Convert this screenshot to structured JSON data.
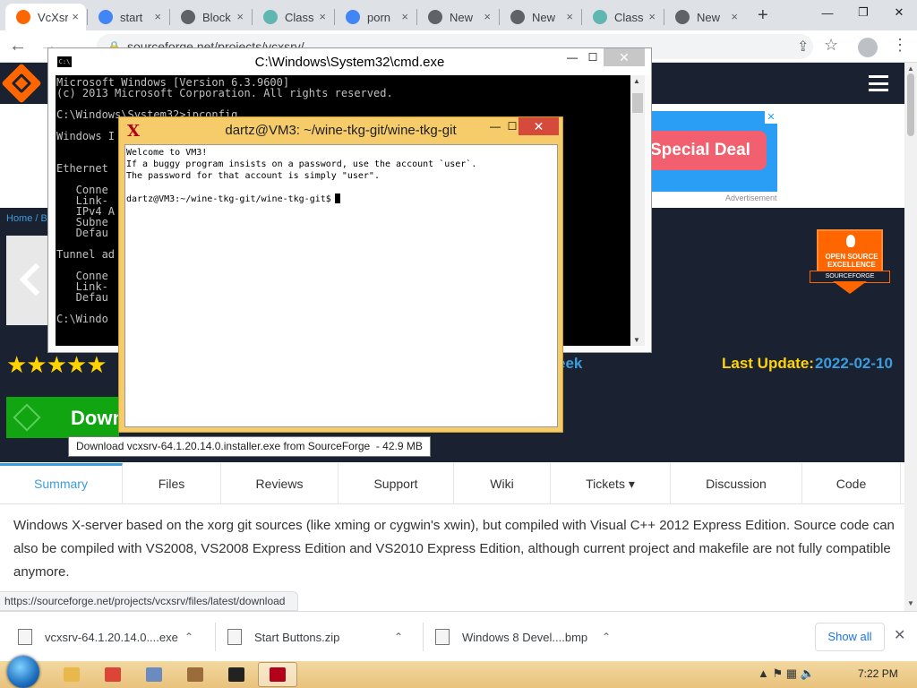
{
  "browser": {
    "tabs": [
      {
        "title": "VcXsr",
        "active": true,
        "favicon_color": "#ff6600"
      },
      {
        "title": "start",
        "active": false,
        "favicon_color": "#4285f4"
      },
      {
        "title": "Block",
        "active": false,
        "favicon_color": "#5f6368"
      },
      {
        "title": "Class",
        "active": false,
        "favicon_color": "#5fb7b0"
      },
      {
        "title": "porn",
        "active": false,
        "favicon_color": "#4285f4"
      },
      {
        "title": "New",
        "active": false,
        "favicon_color": "#5f6368"
      },
      {
        "title": "New",
        "active": false,
        "favicon_color": "#5f6368"
      },
      {
        "title": "Class",
        "active": false,
        "favicon_color": "#5fb7b0"
      },
      {
        "title": "New",
        "active": false,
        "favicon_color": "#5f6368"
      }
    ],
    "new_tab_glyph": "+",
    "tab_close_glyph": "×",
    "window_controls": {
      "minimize": "—",
      "restore": "❐",
      "close": "✕"
    },
    "back_glyph": "←",
    "forward_glyph": "→",
    "url": "sourceforge.net/projects/vcxsrv/",
    "lock_glyph": "🔒",
    "share_glyph": "⇪",
    "star_glyph": "☆",
    "menu_glyph": "⋮"
  },
  "page": {
    "breadcrumb": "Home / B",
    "stars": "★★★★★",
    "week_link": "eek",
    "last_update_label": "Last Update:",
    "last_update_value": "2022-02-10",
    "download_label": "Download",
    "ad": {
      "pill_text": "Special Deal",
      "close_glyph": "✕",
      "label": "Advertisement"
    },
    "badge": {
      "line1": "OPEN SOURCE",
      "line2": "EXCELLENCE",
      "ribbon": "SOURCEFORGE"
    },
    "tooltip": "Download vcxsrv-64.1.20.14.0.installer.exe from SourceForge  - 42.9 MB",
    "tabs": [
      {
        "label": "Summary",
        "active": true
      },
      {
        "label": "Files",
        "active": false
      },
      {
        "label": "Reviews",
        "active": false
      },
      {
        "label": "Support",
        "active": false
      },
      {
        "label": "Wiki",
        "active": false
      },
      {
        "label": "Tickets ▾",
        "active": false
      },
      {
        "label": "Discussion",
        "active": false
      },
      {
        "label": "Code",
        "active": false
      }
    ],
    "description": "Windows X-server based on the xorg git sources (like xming or cygwin's xwin), but compiled with Visual C++ 2012 Express Edition. Source code can also be compiled with VS2008, VS2008 Express Edition and VS2010 Express Edition, although current project and makefile are not fully compatible anymore.",
    "status_url": "https://sourceforge.net/projects/vcxsrv/files/latest/download"
  },
  "downloads": {
    "items": [
      {
        "name": "vcxsrv-64.1.20.14.0....exe",
        "chevron": "⌃"
      },
      {
        "name": "Start Buttons.zip",
        "chevron": "⌃"
      },
      {
        "name": "Windows 8 Devel....bmp",
        "chevron": "⌃"
      }
    ],
    "show_all": "Show all",
    "close_glyph": "✕"
  },
  "cmd": {
    "title": "C:\\Windows\\System32\\cmd.exe",
    "icon_text": "C:\\",
    "controls": {
      "minimize": "—",
      "maximize": "☐",
      "close": "✕"
    },
    "lines": [
      "Microsoft Windows [Version 6.3.9600]",
      "(c) 2013 Microsoft Corporation. All rights reserved.",
      "",
      "C:\\Windows\\System32>ipconfig",
      "",
      "Windows I",
      "",
      "",
      "Ethernet",
      "",
      "   Conne",
      "   Link-",
      "   IPv4 A",
      "   Subne",
      "   Defau",
      "",
      "Tunnel ad",
      "",
      "   Conne",
      "   Link-",
      "   Defau",
      "",
      "C:\\Windo"
    ]
  },
  "xterm": {
    "title": "dartz@VM3: ~/wine-tkg-git/wine-tkg-git",
    "icon_glyph": "X",
    "controls": {
      "minimize": "—",
      "maximize": "☐",
      "close": "✕"
    },
    "lines": [
      "Welcome to VM3!",
      "If a buggy program insists on a password, use the account `user`.",
      "The password for that account is simply \"user\".",
      "",
      "dartz@VM3:~/wine-tkg-git/wine-tkg-git$"
    ]
  },
  "taskbar": {
    "apps": [
      {
        "name": "file-explorer",
        "color": "#e8b84a",
        "active": false
      },
      {
        "name": "chrome",
        "color": "#db4437",
        "active": false
      },
      {
        "name": "app-window",
        "color": "#6a8bbf",
        "active": false
      },
      {
        "name": "paint",
        "color": "#9b6b3b",
        "active": false
      },
      {
        "name": "cmd",
        "color": "#222222",
        "active": false
      },
      {
        "name": "xterm",
        "color": "#b3001b",
        "active": true
      }
    ],
    "tray_glyphs": "▲  ⚑  ▦  🔈",
    "clock": "7:22 PM"
  }
}
